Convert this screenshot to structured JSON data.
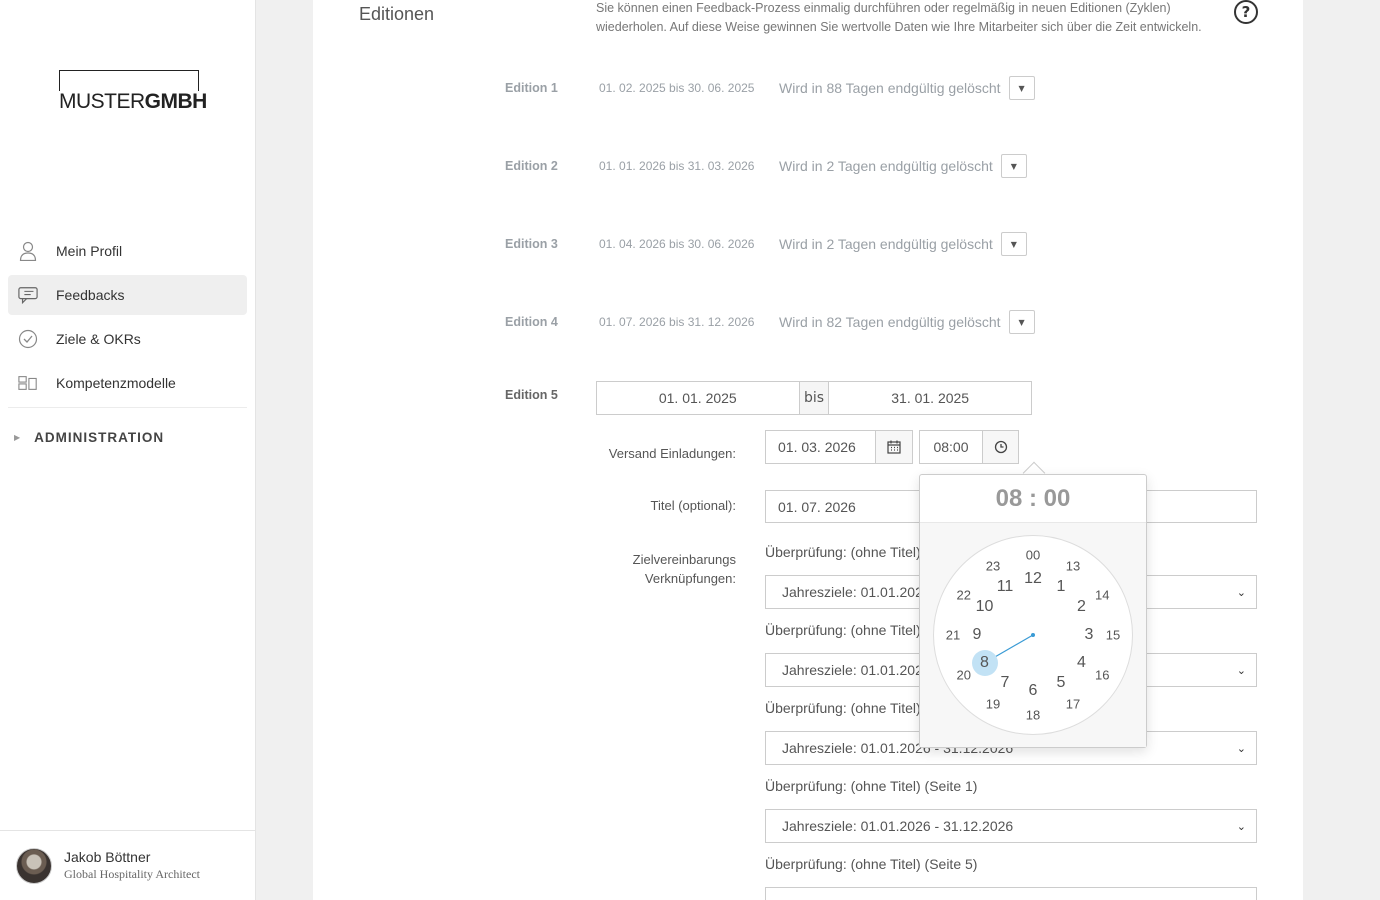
{
  "sidebar": {
    "logo": {
      "part1": "MUSTER",
      "part2": "GMBH"
    },
    "items": [
      {
        "label": "Mein Profil",
        "icon": "user-icon"
      },
      {
        "label": "Feedbacks",
        "icon": "chat-icon"
      },
      {
        "label": "Ziele & OKRs",
        "icon": "check-circle-icon"
      },
      {
        "label": "Kompetenzmodelle",
        "icon": "model-icon"
      }
    ],
    "admin": "ADMINISTRATION",
    "user": {
      "name": "Jakob Böttner",
      "role": "Global Hospitality Architect"
    }
  },
  "main": {
    "section_title": "Editionen",
    "section_desc": "Sie können einen Feedback-Prozess einmalig durchführen oder regelmäßig in neuen Editionen (Zyklen) wiederholen. Auf diese Weise gewinnen Sie wertvolle Daten wie Ihre Mitarbeiter sich über die Zeit entwickeln.",
    "help_icon": "?",
    "editions": [
      {
        "label": "Edition 1",
        "dates": "01. 02. 2025 bis 30. 06. 2025",
        "status": "Wird in 88 Tagen endgültig gelöscht"
      },
      {
        "label": "Edition 2",
        "dates": "01. 01. 2026 bis 31. 03. 2026",
        "status": "Wird in 2 Tagen endgültig gelöscht"
      },
      {
        "label": "Edition 3",
        "dates": "01. 04. 2026 bis 30. 06. 2026",
        "status": "Wird in 2 Tagen endgültig gelöscht"
      },
      {
        "label": "Edition 4",
        "dates": "01. 07. 2026 bis 31. 12. 2026",
        "status": "Wird in 82 Tagen endgültig gelöscht"
      }
    ],
    "edition5": {
      "label": "Edition 5",
      "start": "01. 01. 2025",
      "bis": "bis",
      "end": "31. 01. 2025",
      "invite_label": "Versand Einladungen:",
      "invite_date": "01. 03. 2026",
      "invite_time": "08:00",
      "title_label": "Titel (optional):",
      "title_value": "01. 07. 2026",
      "zv_label": "Zielvereinbarungs Verknüpfungen:",
      "links": [
        {
          "caption": "Überprüfung: (ohne Titel)",
          "select": "Jahresziele: 01.01.2026 - 31.12.2026"
        },
        {
          "caption": "Überprüfung: (ohne Titel)",
          "select": "Jahresziele: 01.01.2026 - 31.12.2026"
        },
        {
          "caption": "Überprüfung: (ohne Titel)",
          "select": "Jahresziele: 01.01.2026 - 31.12.2026"
        },
        {
          "caption": "Überprüfung: (ohne Titel) (Seite 1)",
          "select": "Jahresziele: 01.01.2026 - 31.12.2026"
        },
        {
          "caption": "Überprüfung: (ohne Titel) (Seite 5)",
          "select": ""
        }
      ]
    }
  },
  "clock": {
    "display": "08 : 00",
    "selected_hour": "8",
    "outer": [
      "12",
      "1",
      "2",
      "3",
      "4",
      "5",
      "6",
      "7",
      "8",
      "9",
      "10",
      "11"
    ],
    "inner": [
      "00",
      "13",
      "14",
      "15",
      "16",
      "17",
      "18",
      "19",
      "20",
      "21",
      "22",
      "23"
    ],
    "accent": "#c2e2f5",
    "hand_color": "#3a9bd5"
  }
}
